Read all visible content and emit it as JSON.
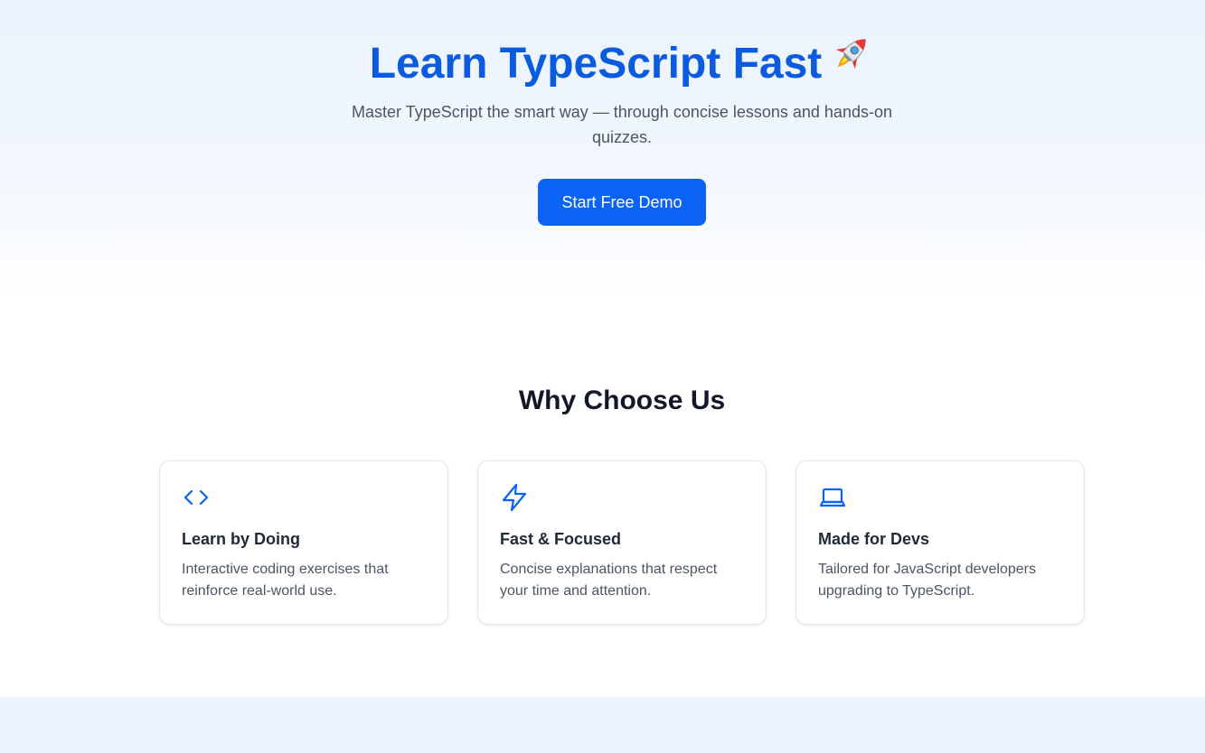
{
  "hero": {
    "title": "Learn TypeScript Fast",
    "title_icon": "rocket-icon",
    "subtitle": "Master TypeScript the smart way — through concise lessons and hands-on quizzes.",
    "cta_label": "Start Free Demo"
  },
  "features": {
    "title": "Why Choose Us",
    "cards": [
      {
        "icon": "code-icon",
        "title": "Learn by Doing",
        "text": "Interactive coding exercises that reinforce real-world use."
      },
      {
        "icon": "lightning-icon",
        "title": "Fast & Focused",
        "text": "Concise explanations that respect your time and attention."
      },
      {
        "icon": "laptop-icon",
        "title": "Made for Devs",
        "text": "Tailored for JavaScript developers upgrading to TypeScript."
      }
    ]
  },
  "colors": {
    "accent": "#0b63f6",
    "title": "#0b5be0",
    "hero_bg": "#eaf3fe"
  }
}
